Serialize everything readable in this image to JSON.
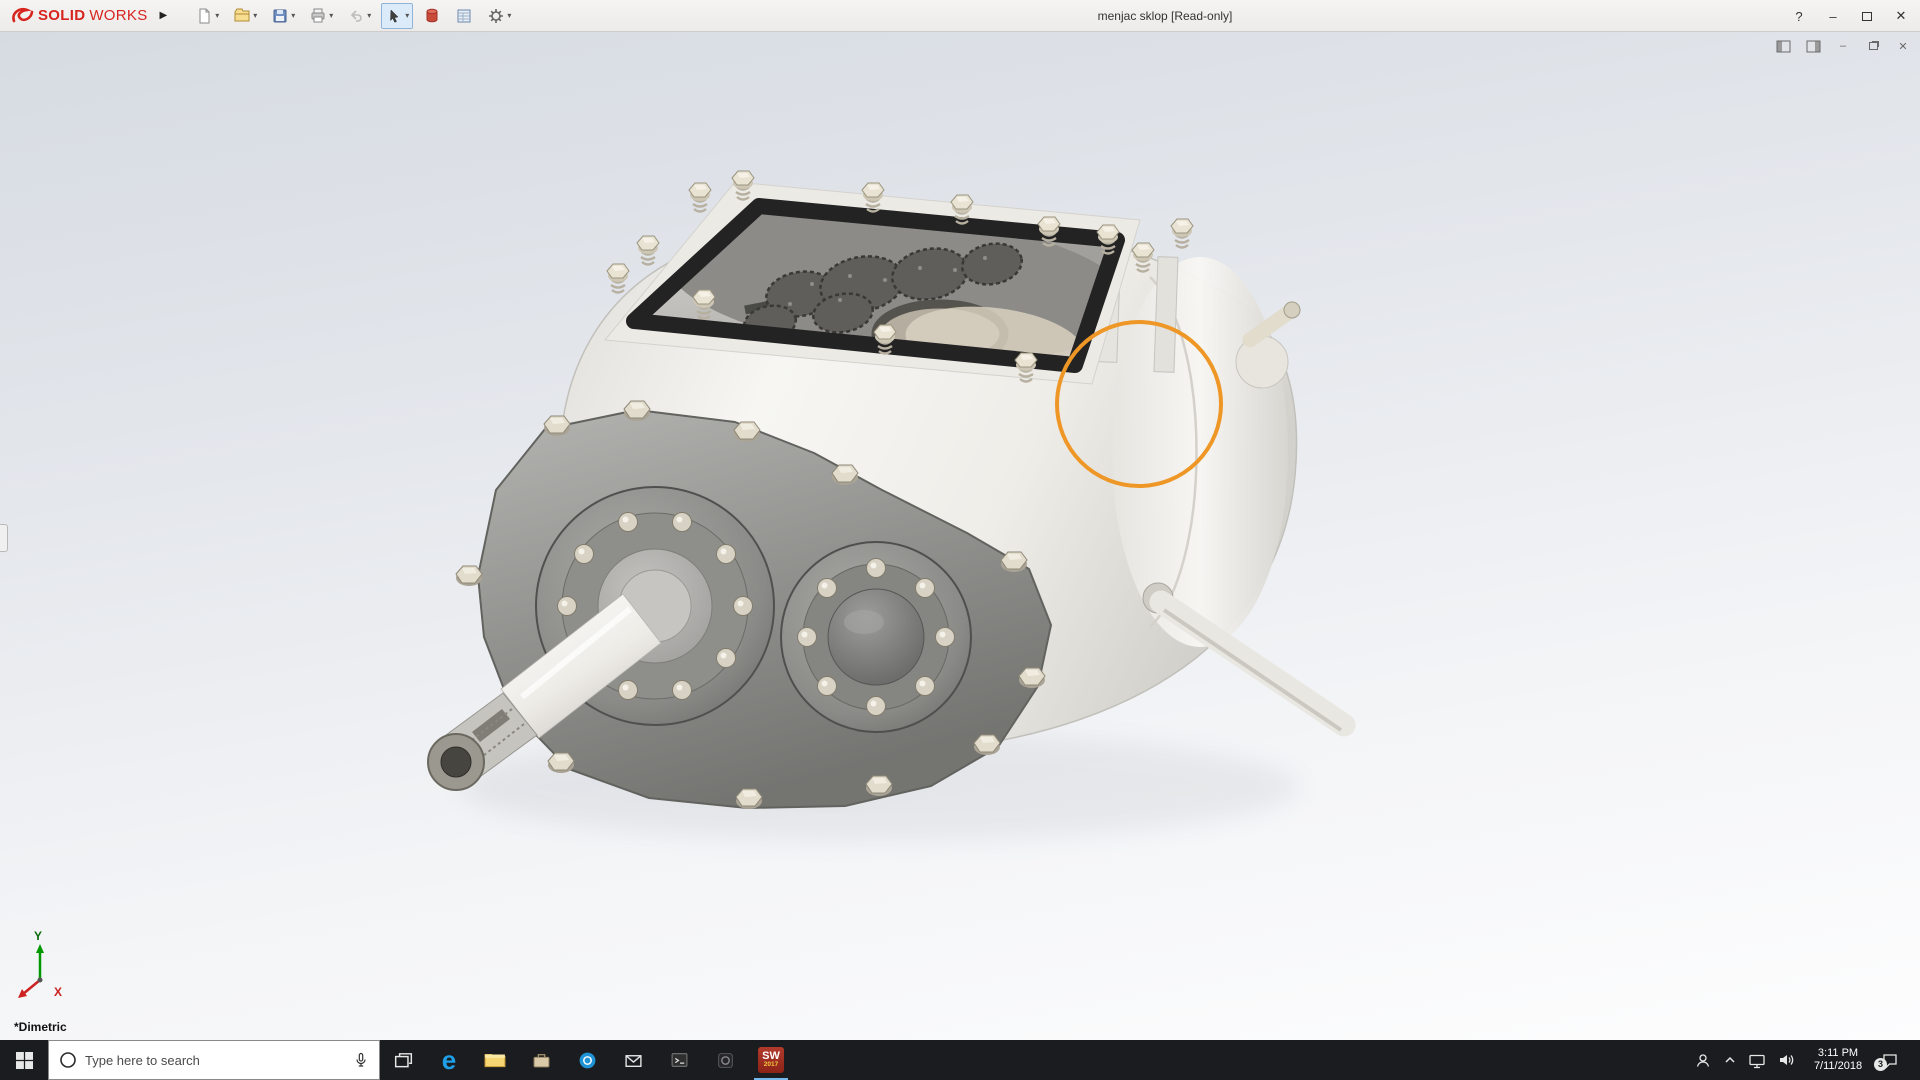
{
  "titlebar": {
    "brand": {
      "bold": "SOLID",
      "light": "WORKS"
    },
    "expander_glyph": "▶",
    "toolbar": {
      "caret": "▾",
      "icons": [
        "new-document",
        "open",
        "save",
        "print",
        "undo",
        "select",
        "appearances",
        "evaluate",
        "options"
      ]
    },
    "title": "menjac sklop [Read-only]",
    "help_label": "?",
    "window": {
      "minimize_glyph": "–",
      "close_glyph": "✕"
    }
  },
  "document_bar": {
    "controls": [
      "pane-left",
      "pane-right",
      "minimize",
      "restore",
      "close"
    ],
    "minimize_glyph": "–",
    "close_glyph": "✕"
  },
  "viewport": {
    "view_orientation_label": "*Dimetric",
    "triad": {
      "x_label": "X",
      "y_label": "Y"
    },
    "annotation_color": "#ee9726",
    "model_description": "gearbox assembly with top cover removed showing internal gears"
  },
  "taskbar": {
    "search": {
      "placeholder": "Type here to search"
    },
    "edge_glyph": "e",
    "apps": [
      "task-view",
      "microsoft-edge",
      "file-explorer",
      "store",
      "skype",
      "mail",
      "command-prompt",
      "dark-app",
      "solidworks-2017"
    ],
    "solidworks_icon": {
      "line1": "SW",
      "line2": "2017"
    },
    "tray_icons": [
      "people",
      "chevron-up",
      "network",
      "volume",
      "action-center"
    ],
    "clock": {
      "time": "3:11 PM",
      "date": "7/11/2018"
    },
    "notification_count": "3"
  },
  "colors": {
    "brand_red": "#d8241f",
    "taskbar_bg": "#1b1c1f",
    "annotation_orange": "#ee9726",
    "edge_blue": "#1e9fe8"
  }
}
